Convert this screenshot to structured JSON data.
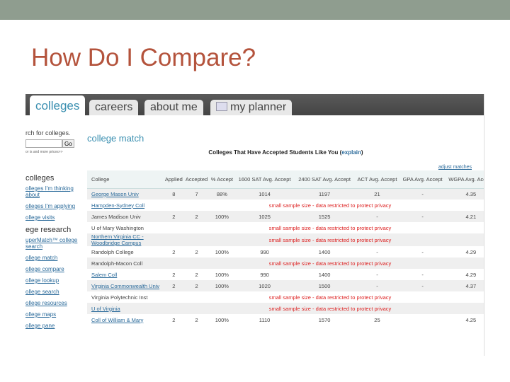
{
  "slide": {
    "title": "How Do I Compare?"
  },
  "tabs": [
    {
      "label": "colleges"
    },
    {
      "label": "careers"
    },
    {
      "label": "about me"
    },
    {
      "label": "my planner",
      "icon": "planner-icon"
    }
  ],
  "sidebar": {
    "search_label": "rch for colleges.",
    "go": "Go",
    "more": "or is and more prices>>",
    "section1": "colleges",
    "links1": [
      "olleges I'm thinking about",
      "olleges I'm applying",
      "ollege visits"
    ],
    "section2": "ege research",
    "links2": [
      "uperMatch™ college search",
      "ollege match",
      "ollege compare",
      "ollege lookup",
      "ollege search",
      "ollege resources",
      "ollege maps",
      "ollege pane"
    ]
  },
  "main": {
    "heading": "college match",
    "subhead": "Colleges That Have Accepted Students Like You (",
    "explain": "explain",
    "close": ")",
    "adjust": "adjust matches",
    "columns": [
      "College",
      "Applied",
      "Accepted",
      "% Accept",
      "1600 SAT Avg. Accept",
      "2400 SAT Avg. Accept",
      "ACT Avg. Accept",
      "GPA Avg. Accept",
      "WGPA Avg. Accept"
    ],
    "restricted": "small sample size - data restricted to protect privacy",
    "rows": [
      {
        "college": "George Mason Univ",
        "link": true,
        "vals": [
          "8",
          "7",
          "88%",
          "1014",
          "1197",
          "21",
          "-",
          "4.35"
        ]
      },
      {
        "college": "Hampden-Sydney Coll",
        "link": true,
        "restricted": true
      },
      {
        "college": "James Madison Univ",
        "link": false,
        "vals": [
          "2",
          "2",
          "100%",
          "1025",
          "1525",
          "-",
          "-",
          "4.21"
        ]
      },
      {
        "college": "U of Mary Washington",
        "link": false,
        "restricted": true
      },
      {
        "college": "Northern Virginia CC - Woodbridge Campus",
        "link": true,
        "restricted": true
      },
      {
        "college": "Randolph College",
        "link": false,
        "vals": [
          "2",
          "2",
          "100%",
          "990",
          "1400",
          "-",
          "-",
          "4.29"
        ]
      },
      {
        "college": "Randolph-Macon Coll",
        "link": false,
        "restricted": true
      },
      {
        "college": "Salem Coll",
        "link": true,
        "vals": [
          "2",
          "2",
          "100%",
          "990",
          "1400",
          "-",
          "-",
          "4.29"
        ]
      },
      {
        "college": "Virginia Commonwealth Univ",
        "link": true,
        "vals": [
          "2",
          "2",
          "100%",
          "1020",
          "1500",
          "-",
          "-",
          "4.37"
        ]
      },
      {
        "college": "Virginia Polytechnic Inst",
        "link": false,
        "restricted": true
      },
      {
        "college": "U of Virginia",
        "link": true,
        "restricted": true
      },
      {
        "college": "Coll of William & Mary",
        "link": true,
        "vals": [
          "2",
          "2",
          "100%",
          "1110",
          "1570",
          "25",
          "",
          "4.25"
        ]
      }
    ]
  }
}
